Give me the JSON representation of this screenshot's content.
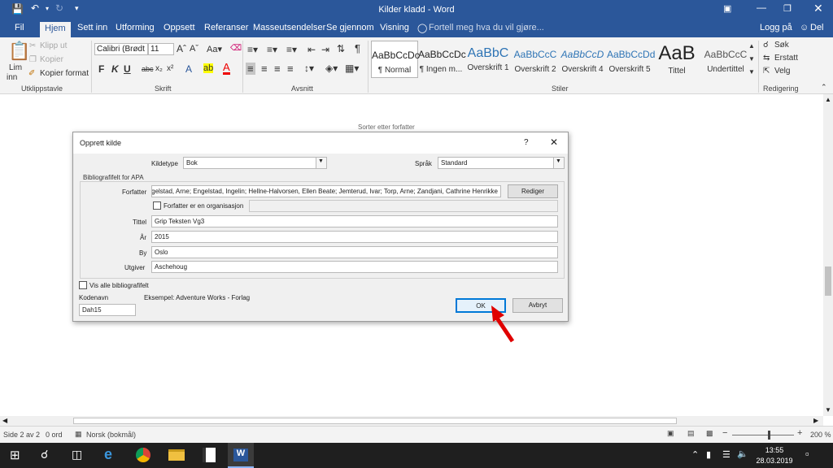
{
  "window": {
    "title": "Kilder kladd - Word"
  },
  "tabs": [
    "Fil",
    "Hjem",
    "Sett inn",
    "Utforming",
    "Oppsett",
    "Referanser",
    "Masseutsendelser",
    "Se gjennom",
    "Visning"
  ],
  "tell_me": "Fortell meg hva du vil gjøre...",
  "account": {
    "login": "Logg på",
    "share": "Del"
  },
  "clipboard": {
    "paste": "Lim",
    "paste2": "inn",
    "cut": "Klipp ut",
    "copy": "Kopier",
    "format_painter": "Kopier format",
    "group": "Utklippstavle"
  },
  "font": {
    "name": "Calibri (Brødt",
    "size": "11",
    "group": "Skrift"
  },
  "paragraph": {
    "group": "Avsnitt"
  },
  "styles": {
    "group": "Stiler",
    "items": [
      {
        "preview": "AaBbCcDc",
        "label": "¶ Normal"
      },
      {
        "preview": "AaBbCcDc",
        "label": "¶ Ingen m..."
      },
      {
        "preview": "AaBbC",
        "label": "Overskrift 1"
      },
      {
        "preview": "AaBbCcC",
        "label": "Overskrift 2"
      },
      {
        "preview": "AaBbCcD",
        "label": "Overskrift 4"
      },
      {
        "preview": "AaBbCcDd",
        "label": "Overskrift 5"
      },
      {
        "preview": "AaB",
        "label": "Tittel"
      },
      {
        "preview": "AaBbCcC",
        "label": "Undertittel"
      }
    ]
  },
  "editing": {
    "find": "Søk",
    "replace": "Erstatt",
    "select": "Velg",
    "group": "Redigering"
  },
  "background": {
    "behind_text": "Sorter etter forfatter"
  },
  "dialog": {
    "title": "Opprett kilde",
    "help": "?",
    "source_type_label": "Kildetype",
    "source_type": "Bok",
    "language_label": "Språk",
    "language": "Standard",
    "group_label": "Bibliografifelt for APA",
    "author_label": "Forfatter",
    "author_value": "e; Engelstad, Arne; Engelstad, Ingelin; Hellne-Halvorsen, Ellen Beate; Jemterud, Ivar; Torp, Arne; Zandjani, Cathrine Henrikke",
    "edit_button": "Rediger",
    "corporate_label": "Forfatter er en organisasjon",
    "title_label": "Tittel",
    "title_value": "Grip Teksten Vg3",
    "year_label": "År",
    "year_value": "2015",
    "city_label": "By",
    "city_value": "Oslo",
    "publisher_label": "Utgiver",
    "publisher_value": "Aschehoug",
    "show_all_label": "Vis alle bibliografifelt",
    "tag_label": "Kodenavn",
    "tag_value": "Dah15",
    "example": "Eksempel: Adventure Works - Forlag",
    "ok": "OK",
    "cancel": "Avbryt"
  },
  "status": {
    "page": "Side 2 av 2",
    "words": "0 ord",
    "language": "Norsk (bokmål)",
    "zoom": "200 %"
  },
  "clock": {
    "time": "13:55",
    "date": "28.03.2019"
  },
  "colors": {
    "word_blue": "#2b579a",
    "arrow_red": "#e00000",
    "ok_border": "#0078d7"
  }
}
